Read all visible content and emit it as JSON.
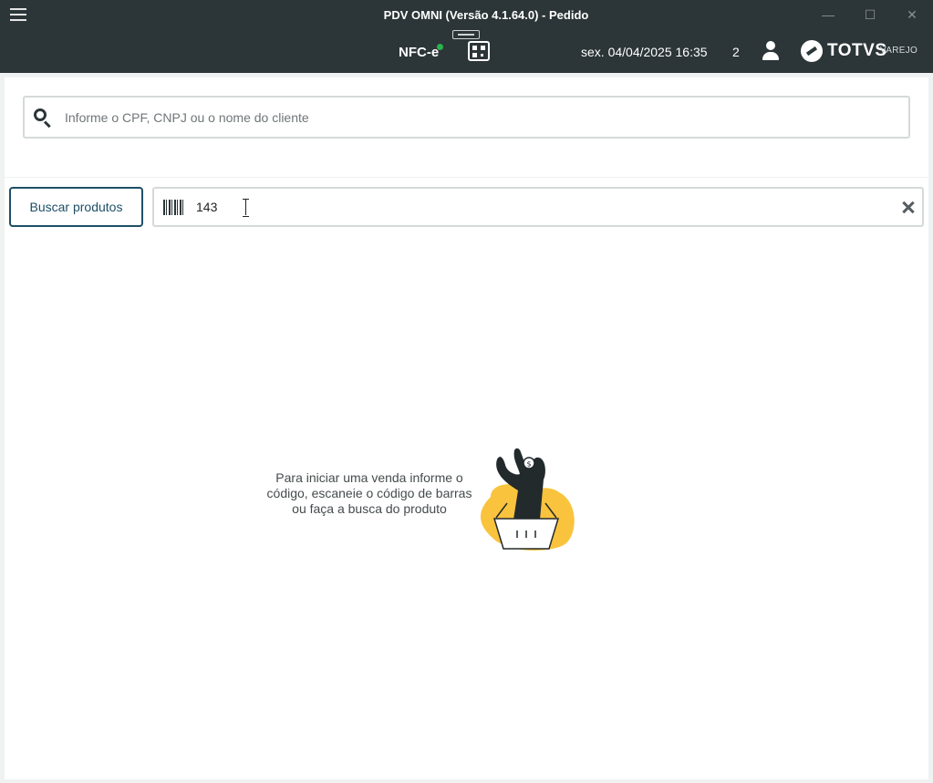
{
  "window": {
    "title": "PDV OMNI (Versão 4.1.64.0) - Pedido",
    "minimize_symbol": "—",
    "maximize_symbol": "☐",
    "close_symbol": "✕"
  },
  "header": {
    "nfce_label": "NFC-e",
    "nfce_status_color": "#2bb34b",
    "datetime": "sex. 04/04/2025 16:35",
    "counter": "2",
    "brand": "TOTVS",
    "brand_suffix": "VAREJO"
  },
  "client_search": {
    "placeholder": "Informe o CPF, CNPJ ou o nome do cliente",
    "value": ""
  },
  "product_search": {
    "button_label": "Buscar produtos",
    "code_value": "143"
  },
  "empty_state": {
    "message": "Para iniciar uma venda informe o código, escaneie o código de barras ou faça a busca do produto"
  },
  "colors": {
    "titlebar_bg": "#2c3538",
    "accent": "#1d4f67",
    "illustration_yellow": "#f9c33d"
  }
}
